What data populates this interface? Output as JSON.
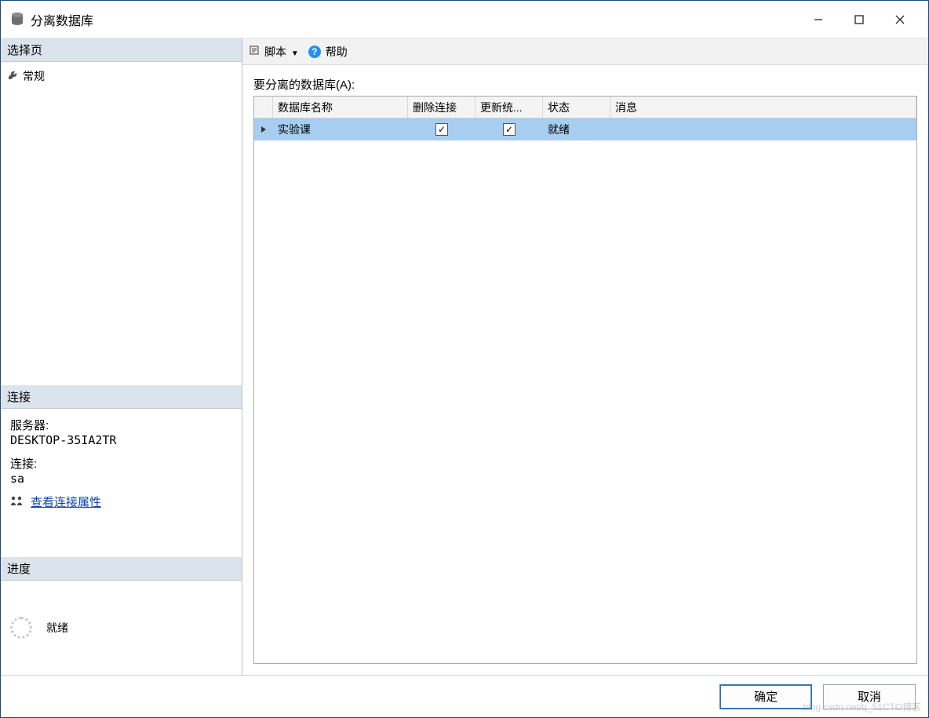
{
  "window": {
    "title": "分离数据库"
  },
  "sidebar": {
    "select_page_header": "选择页",
    "general_label": "常规",
    "connection_header": "连接",
    "server_label": "服务器:",
    "server_value": "DESKTOP-35IA2TR",
    "conn_label": "连接:",
    "conn_value": "sa",
    "view_conn_props": "查看连接属性",
    "progress_header": "进度",
    "progress_status": "就绪"
  },
  "toolbar": {
    "script_label": "脚本",
    "help_label": "帮助"
  },
  "content": {
    "section_label": "要分离的数据库(A):",
    "columns": {
      "name": "数据库名称",
      "delete_conn": "删除连接",
      "update_stats": "更新统...",
      "status": "状态",
      "message": "消息"
    },
    "rows": [
      {
        "name": "实验课",
        "delete_conn": true,
        "update_stats": true,
        "status": "就绪",
        "message": ""
      }
    ]
  },
  "footer": {
    "ok": "确定",
    "cancel": "取消"
  },
  "watermark": "blog.csdn.net/q_51CTO博客"
}
